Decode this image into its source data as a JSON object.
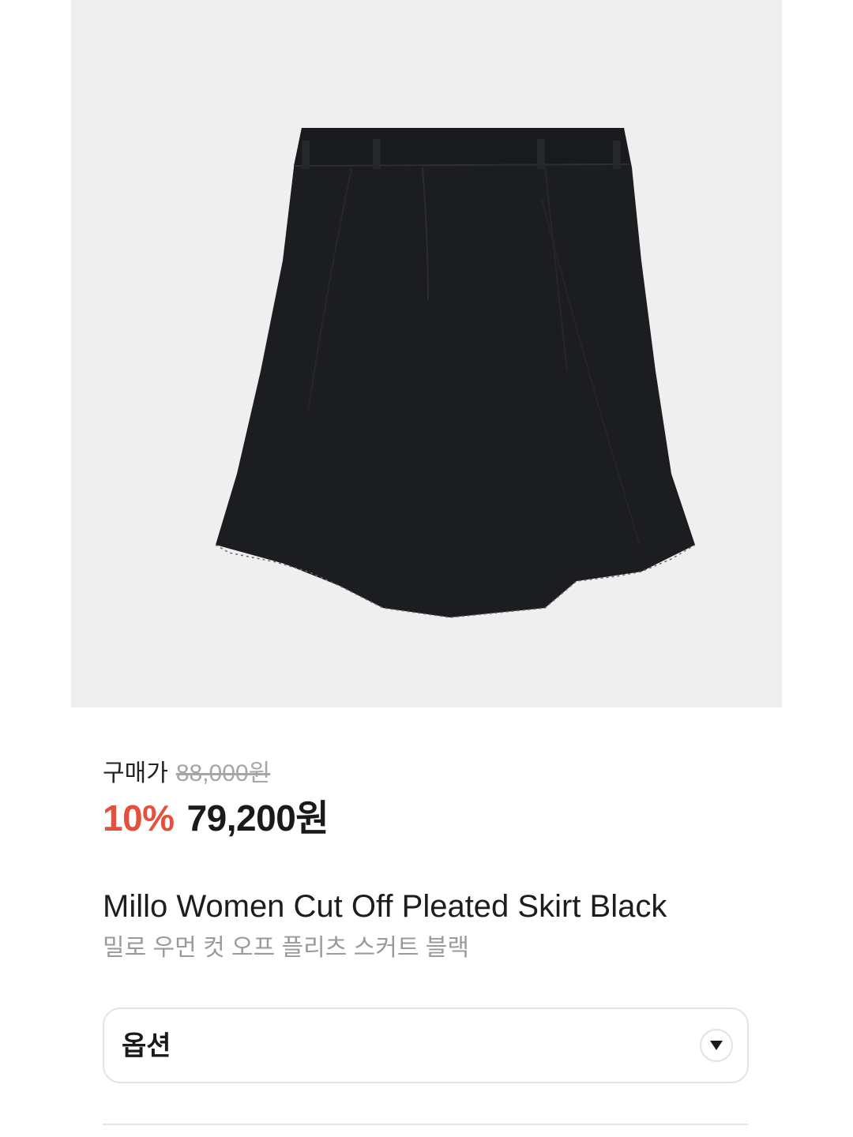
{
  "product": {
    "image_alt": "Black cut-off pleated skirt",
    "price": {
      "label": "구매가",
      "original": "88,000원",
      "discount": "10%",
      "final": "79,200원"
    },
    "name_en": "Millo Women Cut Off Pleated Skirt Black",
    "name_ko": "밀로 우먼 컷 오프 플리츠 스커트 블랙"
  },
  "option": {
    "label": "옵션",
    "icon": "chevron-down-icon"
  },
  "colors": {
    "discount": "#e5503e",
    "image_bg": "#efefef",
    "skirt": "#1c1d21"
  }
}
